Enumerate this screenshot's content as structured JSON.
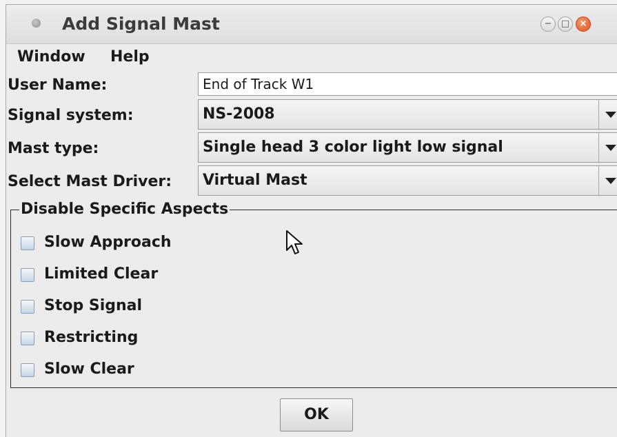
{
  "window": {
    "title": "Add Signal Mast"
  },
  "menu": {
    "items": [
      "Window",
      "Help"
    ]
  },
  "form": {
    "user_name_label": "User Name:",
    "user_name_value": "End of Track W1",
    "signal_system_label": "Signal system:",
    "signal_system_value": "NS-2008",
    "mast_type_label": "Mast type:",
    "mast_type_value": "Single head 3 color light low signal",
    "mast_driver_label": "Select Mast Driver:",
    "mast_driver_value": "Virtual Mast"
  },
  "aspects": {
    "title": "Disable Specific Aspects",
    "items": [
      {
        "label": "Slow Approach",
        "checked": false
      },
      {
        "label": "Limited Clear",
        "checked": false
      },
      {
        "label": "Stop Signal",
        "checked": false
      },
      {
        "label": "Restricting",
        "checked": false
      },
      {
        "label": "Slow Clear",
        "checked": false
      }
    ]
  },
  "buttons": {
    "ok": "OK"
  },
  "colors": {
    "close_button": "#e0531f",
    "checkbox": "#c6d6e6",
    "background": "#ececec"
  }
}
